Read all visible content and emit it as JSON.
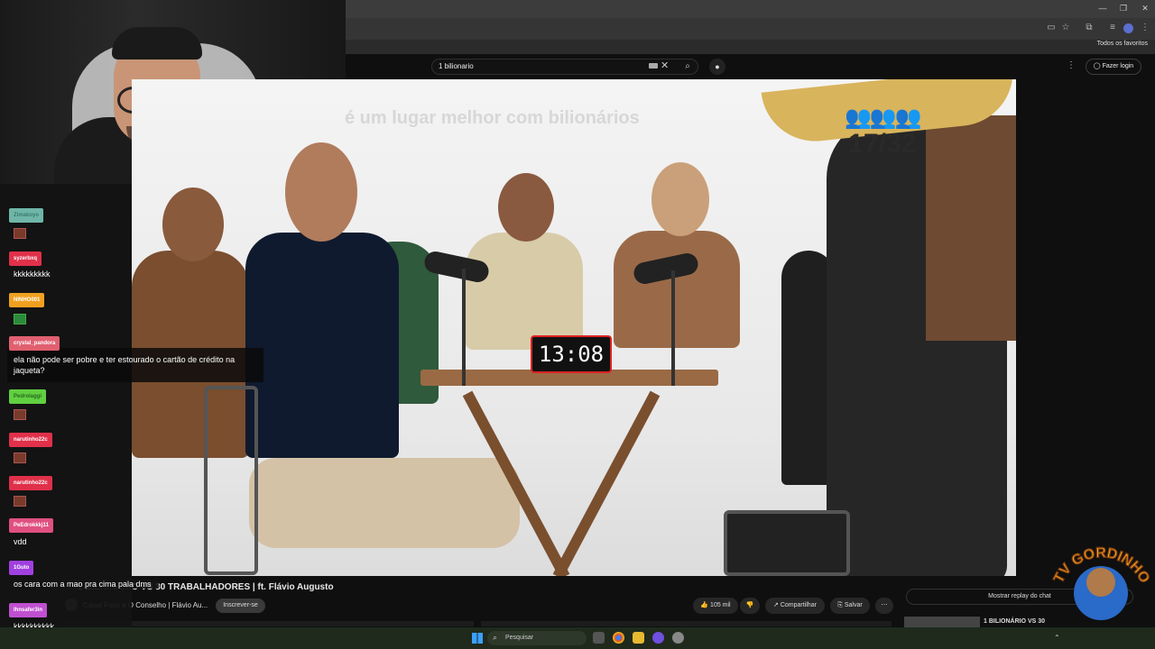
{
  "browser": {
    "bookmarks_label": "Todos os favoritos"
  },
  "youtube": {
    "search": {
      "value": "1 bilionario"
    },
    "login_label": "Fazer login"
  },
  "video": {
    "caption": "é um lugar melhor com bilionários",
    "counter": "17/32",
    "timer": "13:08",
    "title": "1 BILIONÁRIO VS 30 TRABALHADORES | ft. Flávio Augusto",
    "channel": "Canal Foco e O Conselho | Flávio Au...",
    "subscribe_label": "Inscrever-se",
    "likes": "105 mil",
    "share_label": "Compartilhar",
    "save_label": "Salvar",
    "show_chat_replay": "Mostrar replay do chat",
    "rec_title": "1 BILIONÁRIO VS 30"
  },
  "chat": {
    "messages": [
      {
        "user": "Zimakoyo",
        "color": "#6fb6a8",
        "text": ""
      },
      {
        "user": "syzerbxq",
        "color": "#e0304a",
        "text": "kkkkkkkkk"
      },
      {
        "user": "NINHO001",
        "color": "#f0a020",
        "text": ""
      },
      {
        "user": "crystal_pandora",
        "color": "#e06070",
        "text": "ela não pode ser pobre e ter estourado o cartão de crédito na jaqueta?"
      },
      {
        "user": "Pedrolaggi",
        "color": "#60d040",
        "text": ""
      },
      {
        "user": "narutinho22c",
        "color": "#e0304a",
        "text": ""
      },
      {
        "user": "narutinho22c",
        "color": "#e0304a",
        "text": ""
      },
      {
        "user": "PeEdrokkkj11",
        "color": "#e05080",
        "text": "vdd"
      },
      {
        "user": "1Guto",
        "color": "#a040e0",
        "text": "os cara com a mao pra cima pala dms"
      },
      {
        "user": "Ihnsafer3in",
        "color": "#c050d0",
        "text": "kkkkkkkkkk"
      }
    ]
  },
  "logo": {
    "text": "TV GORDINHO"
  },
  "taskbar": {
    "search_placeholder": "Pesquisar"
  },
  "colors": {
    "bg": "#0f0f0f",
    "timer_border": "#dd2222"
  }
}
